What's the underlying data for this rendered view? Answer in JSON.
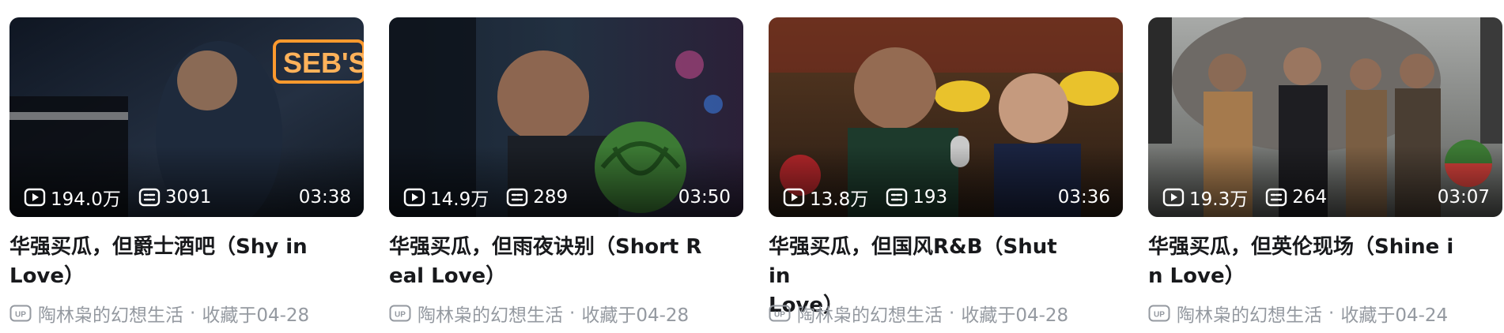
{
  "cards": [
    {
      "title_lines": [
        "华强买瓜，但爵士酒吧（Shy in",
        "Love）"
      ],
      "views": "194.0万",
      "danmaku": "3091",
      "duration": "03:38",
      "owner": "陶林枭的幻想生活",
      "separator": "·",
      "fav_date": "收藏于04-28",
      "sign_text": "SEB'S",
      "palette": {
        "bg": "#1c2433",
        "accent": "#ff9a2e"
      }
    },
    {
      "title_lines": [
        "华强买瓜，但雨夜诀别（Short R",
        "eal Love）"
      ],
      "views": "14.9万",
      "danmaku": "289",
      "duration": "03:50",
      "owner": "陶林枭的幻想生活",
      "separator": "·",
      "fav_date": "收藏于04-28",
      "palette": {
        "bg": "#16202c",
        "accent": "#3f7f3a"
      }
    },
    {
      "title_lines": [
        "华强买瓜，但国风R&B（Shut in",
        "Love）"
      ],
      "views": "13.8万",
      "danmaku": "193",
      "duration": "03:36",
      "owner": "陶林枭的幻想生活",
      "separator": "·",
      "fav_date": "收藏于04-28",
      "palette": {
        "bg": "#3a2a1e",
        "accent": "#e9c22c"
      }
    },
    {
      "title_lines": [
        "华强买瓜，但英伦现场（Shine i",
        "n Love）"
      ],
      "views": "19.3万",
      "danmaku": "264",
      "duration": "03:07",
      "owner": "陶林枭的幻想生活",
      "separator": "·",
      "fav_date": "收藏于04-24",
      "palette": {
        "bg": "#7a7f84",
        "accent": "#b0532e"
      }
    }
  ],
  "icons": {
    "play": "play-count-icon",
    "danmaku": "danmaku-count-icon",
    "up": "up-badge-icon"
  }
}
